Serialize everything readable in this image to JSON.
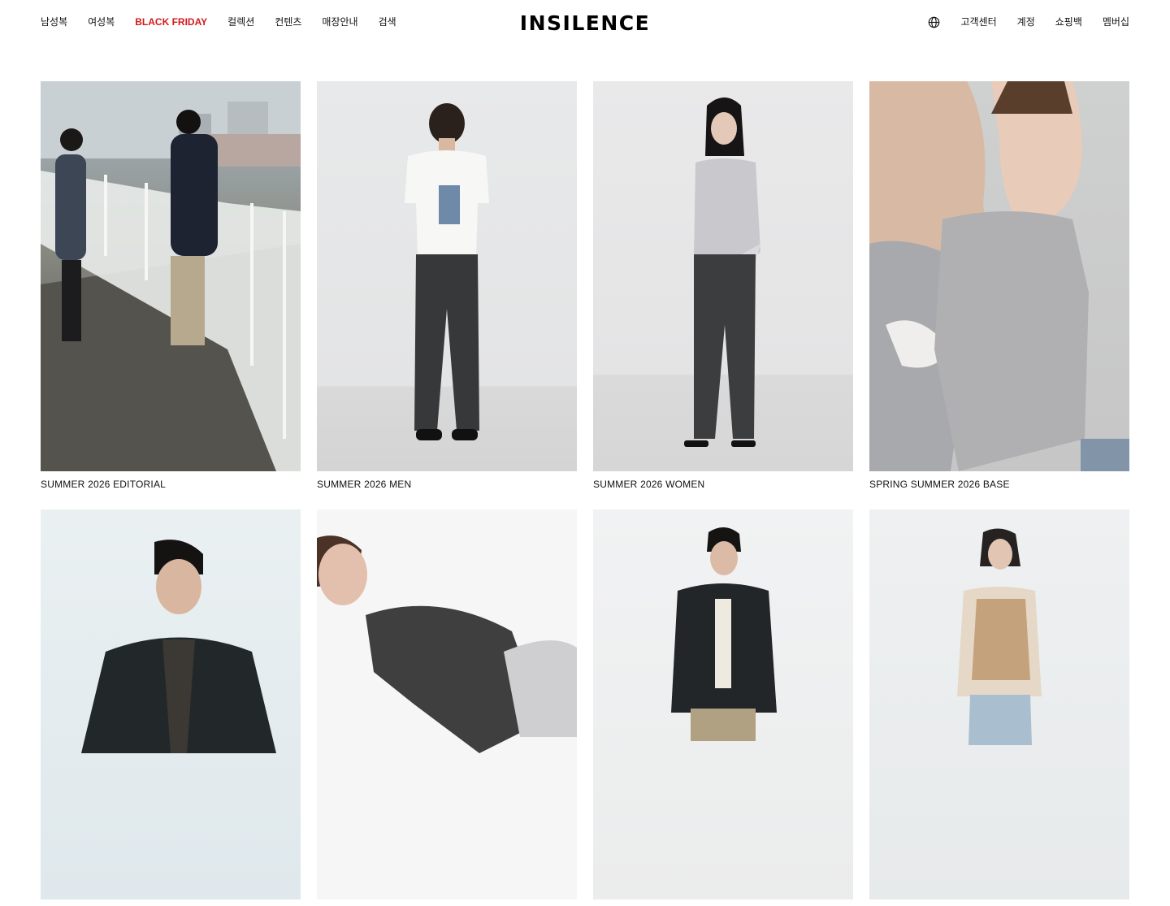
{
  "header": {
    "logo": "INSILENCE",
    "nav_left": [
      {
        "label": "남성복",
        "name": "nav-men"
      },
      {
        "label": "여성복",
        "name": "nav-women"
      },
      {
        "label": "BLACK FRIDAY",
        "name": "nav-black-friday",
        "accent": true
      },
      {
        "label": "컬렉션",
        "name": "nav-collection"
      },
      {
        "label": "컨텐츠",
        "name": "nav-contents"
      },
      {
        "label": "매장안내",
        "name": "nav-stores"
      },
      {
        "label": "검색",
        "name": "nav-search"
      }
    ],
    "nav_right": [
      {
        "label": "고객센터",
        "name": "nav-customer-center"
      },
      {
        "label": "계정",
        "name": "nav-account"
      },
      {
        "label": "쇼핑백",
        "name": "nav-shopping-bag"
      },
      {
        "label": "멤버십",
        "name": "nav-membership"
      }
    ],
    "globe_icon": "globe-icon"
  },
  "colors": {
    "accent": "#d31a1a",
    "text": "#111111",
    "background": "#ffffff"
  },
  "collections": [
    {
      "title": "SUMMER 2026 EDITORIAL"
    },
    {
      "title": "SUMMER 2026 MEN"
    },
    {
      "title": "SUMMER 2026 WOMEN"
    },
    {
      "title": "SPRING SUMMER 2026 BASE"
    },
    {
      "title": ""
    },
    {
      "title": ""
    },
    {
      "title": ""
    },
    {
      "title": ""
    }
  ]
}
